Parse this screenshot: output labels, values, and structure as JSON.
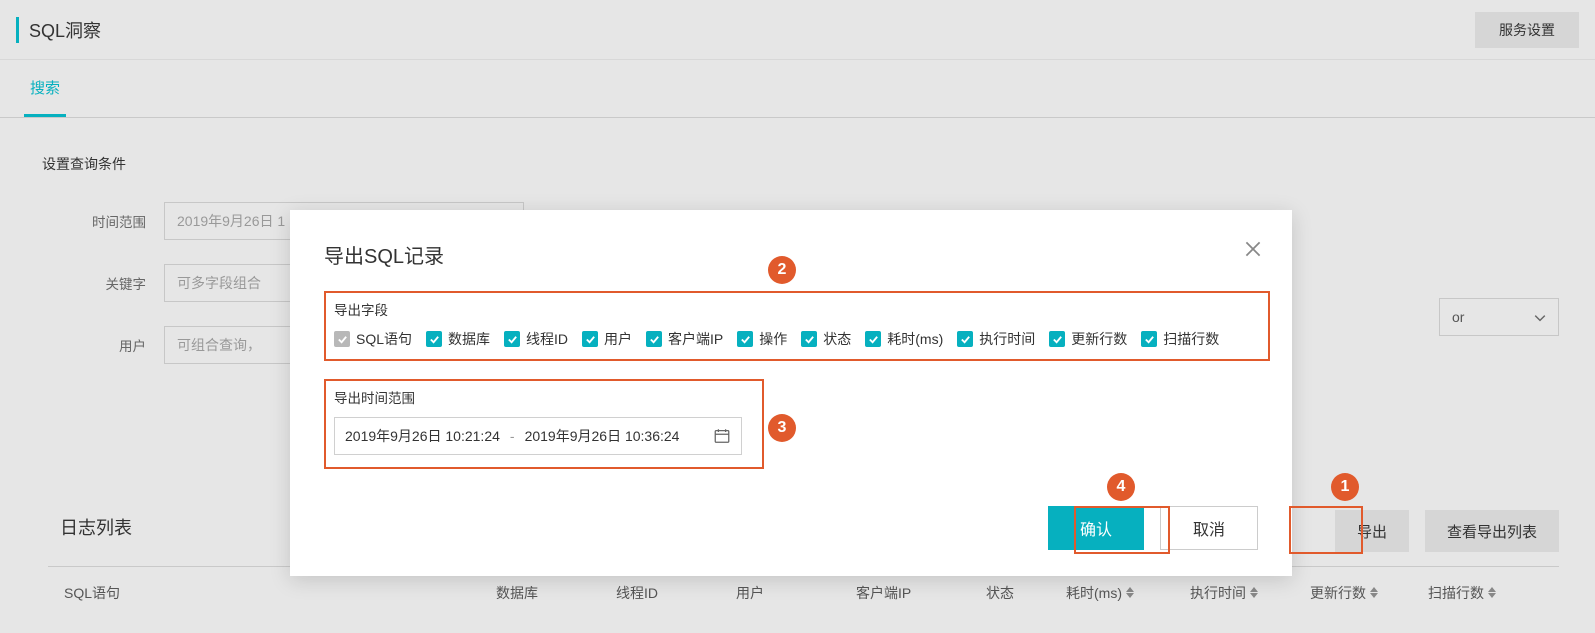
{
  "header": {
    "title": "SQL洞察",
    "settings_btn": "服务设置"
  },
  "tabs": {
    "search": "搜索"
  },
  "query": {
    "section_label": "设置查询条件",
    "row_time_label": "时间范围",
    "row_time_value": "2019年9月26日 1",
    "row_keyword_label": "关键字",
    "row_keyword_ph": "可多字段组合",
    "row_user_label": "用户",
    "row_user_ph": "可组合查询，",
    "or_select": "or"
  },
  "log": {
    "title": "日志列表",
    "export_btn": "导出",
    "view_list_btn": "查看导出列表",
    "cols": {
      "sql": "SQL语句",
      "db": "数据库",
      "thread": "线程ID",
      "user": "用户",
      "ip": "客户端IP",
      "state": "状态",
      "cost": "耗时(ms)",
      "time": "执行时间",
      "upd": "更新行数",
      "scan": "扫描行数"
    }
  },
  "modal": {
    "title": "导出SQL记录",
    "fields_label": "导出字段",
    "checks": [
      {
        "label": "SQL语句",
        "checked": true,
        "disabled": true
      },
      {
        "label": "数据库",
        "checked": true,
        "disabled": false
      },
      {
        "label": "线程ID",
        "checked": true,
        "disabled": false
      },
      {
        "label": "用户",
        "checked": true,
        "disabled": false
      },
      {
        "label": "客户端IP",
        "checked": true,
        "disabled": false
      },
      {
        "label": "操作",
        "checked": true,
        "disabled": false
      },
      {
        "label": "状态",
        "checked": true,
        "disabled": false
      },
      {
        "label": "耗时(ms)",
        "checked": true,
        "disabled": false
      },
      {
        "label": "执行时间",
        "checked": true,
        "disabled": false
      },
      {
        "label": "更新行数",
        "checked": true,
        "disabled": false
      },
      {
        "label": "扫描行数",
        "checked": true,
        "disabled": false
      }
    ],
    "time_label": "导出时间范围",
    "time_from": "2019年9月26日 10:21:24",
    "time_to": "2019年9月26日 10:36:24",
    "confirm": "确认",
    "cancel": "取消"
  },
  "callouts": {
    "c1": "1",
    "c2": "2",
    "c3": "3",
    "c4": "4"
  }
}
